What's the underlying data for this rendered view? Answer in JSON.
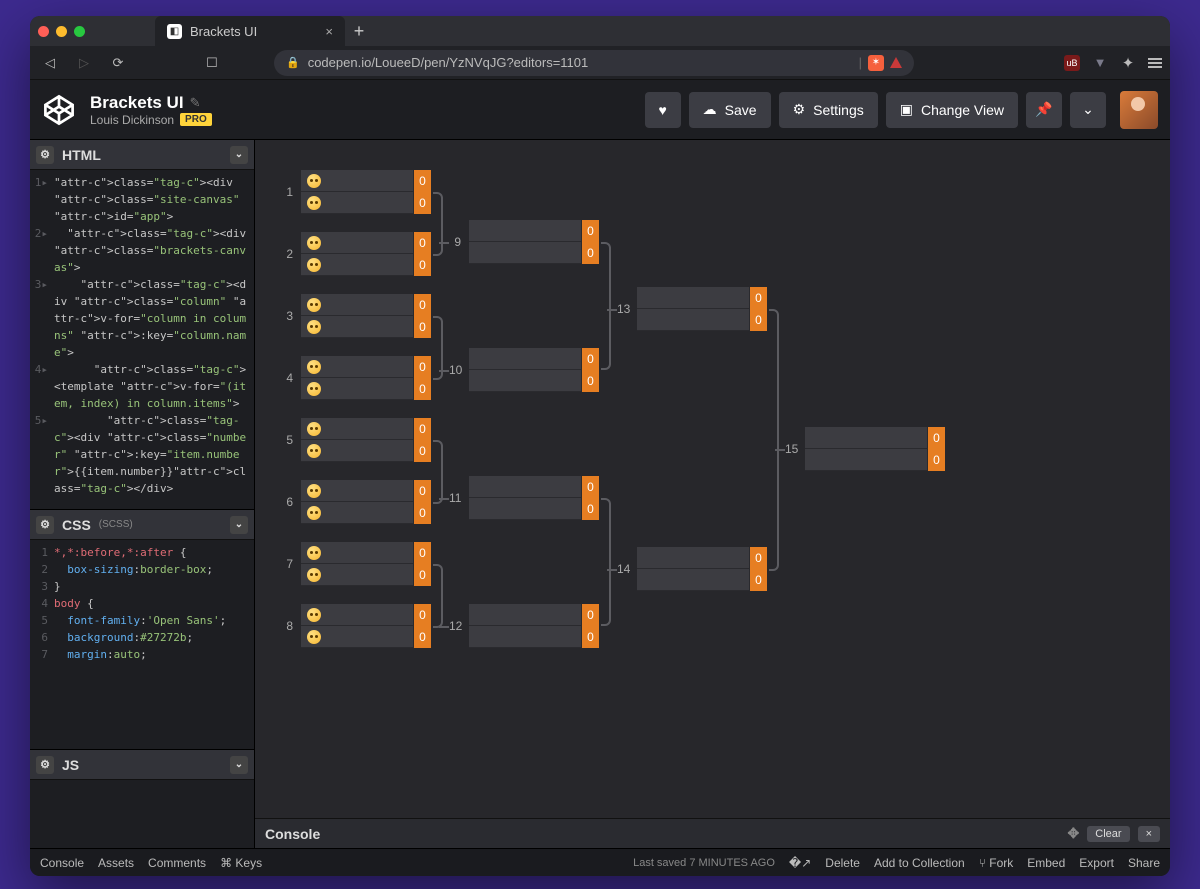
{
  "browser": {
    "tab_title": "Brackets UI",
    "url": "codepen.io/LoueeD/pen/YzNVqJG?editors=1101"
  },
  "header": {
    "pen_title": "Brackets UI",
    "author": "Louis Dickinson",
    "pro_label": "PRO",
    "buttons": {
      "save": "Save",
      "settings": "Settings",
      "change_view": "Change View"
    }
  },
  "editors": {
    "html": {
      "label": "HTML",
      "lines": [
        "<div class=\"site-canvas\" id=\"app\">",
        "  <div class=\"brackets-canvas\">",
        "    <div class=\"column\" v-for=\"column in columns\" :key=\"column.name\">",
        "      <template v-for=\"(item, index) in column.items\">",
        "        <div class=\"number\" :key=\"item.number\">{{item.number}}</div>"
      ]
    },
    "css": {
      "label": "CSS",
      "sub": "(SCSS)",
      "lines": [
        "*,*:before,*:after {",
        "  box-sizing:border-box;",
        "}",
        "body {",
        "  font-family:'Open Sans';",
        "  background:#27272b;",
        "  margin:auto;"
      ]
    },
    "js": {
      "label": "JS"
    }
  },
  "bracket": {
    "columns": [
      {
        "matches": [
          {
            "n": 1,
            "t": [
              {
                "e": "😀",
                "s": 0
              },
              {
                "e": "😃",
                "s": 0
              }
            ]
          },
          {
            "n": 2,
            "t": [
              {
                "e": "😐",
                "s": 0
              },
              {
                "e": "🙂",
                "s": 0
              }
            ]
          },
          {
            "n": 3,
            "t": [
              {
                "e": "😄",
                "s": 0
              },
              {
                "e": "😁",
                "s": 0
              }
            ]
          },
          {
            "n": 4,
            "t": [
              {
                "e": "😂",
                "s": 0
              },
              {
                "e": "😉",
                "s": 0
              }
            ]
          },
          {
            "n": 5,
            "t": [
              {
                "e": "😆",
                "s": 0
              },
              {
                "e": "😅",
                "s": 0
              }
            ]
          },
          {
            "n": 6,
            "t": [
              {
                "e": "😊",
                "s": 0
              },
              {
                "e": "😨",
                "s": 0
              }
            ]
          },
          {
            "n": 7,
            "t": [
              {
                "e": "🙂",
                "s": 0
              },
              {
                "e": "😶",
                "s": 0
              }
            ]
          },
          {
            "n": 8,
            "t": [
              {
                "e": "😏",
                "s": 0
              },
              {
                "e": "😒",
                "s": 0
              }
            ]
          }
        ]
      },
      {
        "matches": [
          {
            "n": 9,
            "t": [
              {
                "e": "",
                "s": 0
              },
              {
                "e": "",
                "s": 0
              }
            ]
          },
          {
            "n": 10,
            "t": [
              {
                "e": "",
                "s": 0
              },
              {
                "e": "",
                "s": 0
              }
            ]
          },
          {
            "n": 11,
            "t": [
              {
                "e": "",
                "s": 0
              },
              {
                "e": "",
                "s": 0
              }
            ]
          },
          {
            "n": 12,
            "t": [
              {
                "e": "",
                "s": 0
              },
              {
                "e": "",
                "s": 0
              }
            ]
          }
        ]
      },
      {
        "matches": [
          {
            "n": 13,
            "t": [
              {
                "e": "",
                "s": 0
              },
              {
                "e": "",
                "s": 0
              }
            ]
          },
          {
            "n": 14,
            "t": [
              {
                "e": "",
                "s": 0
              },
              {
                "e": "",
                "s": 0
              }
            ]
          }
        ]
      },
      {
        "matches": [
          {
            "n": 15,
            "t": [
              {
                "e": "",
                "s": 0
              },
              {
                "e": "",
                "s": 0
              }
            ]
          }
        ]
      }
    ]
  },
  "console": {
    "label": "Console",
    "clear": "Clear"
  },
  "footer": {
    "left": [
      "Console",
      "Assets",
      "Comments",
      "⌘ Keys"
    ],
    "saved": "Last saved 7 MINUTES AGO",
    "right": [
      "Delete",
      "Add to Collection",
      "Fork",
      "Embed",
      "Export",
      "Share"
    ]
  }
}
